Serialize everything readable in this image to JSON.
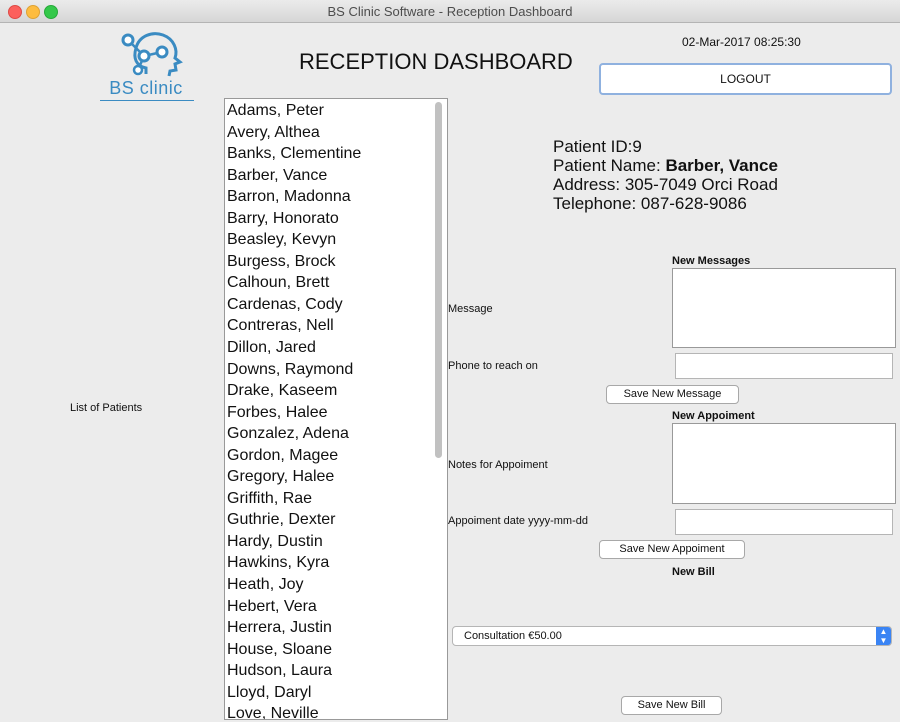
{
  "window": {
    "title": "BS Clinic Software - Reception Dashboard"
  },
  "logo": {
    "text": "BS clinic"
  },
  "header": {
    "title": "RECEPTION DASHBOARD",
    "datetime": "02-Mar-2017 08:25:30",
    "logout_label": "LOGOUT"
  },
  "patients": {
    "label": "List of Patients",
    "items": [
      "Adams, Peter",
      "Avery, Althea",
      "Banks, Clementine",
      "Barber, Vance",
      "Barron, Madonna",
      "Barry, Honorato",
      "Beasley, Kevyn",
      "Burgess, Brock",
      "Calhoun, Brett",
      "Cardenas, Cody",
      "Contreras, Nell",
      "Dillon, Jared",
      "Downs, Raymond",
      "Drake, Kaseem",
      "Forbes, Halee",
      "Gonzalez, Adena",
      "Gordon, Magee",
      "Gregory, Halee",
      "Griffith, Rae",
      "Guthrie, Dexter",
      "Hardy, Dustin",
      "Hawkins, Kyra",
      "Heath, Joy",
      "Hebert, Vera",
      "Herrera, Justin",
      "House, Sloane",
      "Hudson, Laura",
      "Lloyd, Daryl",
      "Love, Neville"
    ]
  },
  "patient_info": {
    "id_label": "Patient ID:",
    "id": "9",
    "name_label": "Patient Name: ",
    "name": "Barber, Vance",
    "address_label": "Address: ",
    "address": "305-7049 Orci Road",
    "phone_label": "Telephone: ",
    "phone": "087-628-9086"
  },
  "messages": {
    "title": "New Messages",
    "message_label": "Message",
    "phone_label": "Phone to reach on",
    "message_value": "",
    "phone_value": "",
    "save_label": "Save New Message"
  },
  "appointment": {
    "title": "New Appoiment",
    "notes_label": "Notes for Appoiment",
    "date_label": "Appoiment date yyyy-mm-dd",
    "notes_value": "",
    "date_value": "",
    "save_label": "Save New Appoiment"
  },
  "bill": {
    "title": "New Bill",
    "selected": "Consultation €50.00",
    "save_label": "Save New Bill"
  },
  "colors": {
    "logo_blue": "#3a8bc2",
    "focus_blue": "#8fb1df",
    "select_blue": "#3a84f4"
  }
}
